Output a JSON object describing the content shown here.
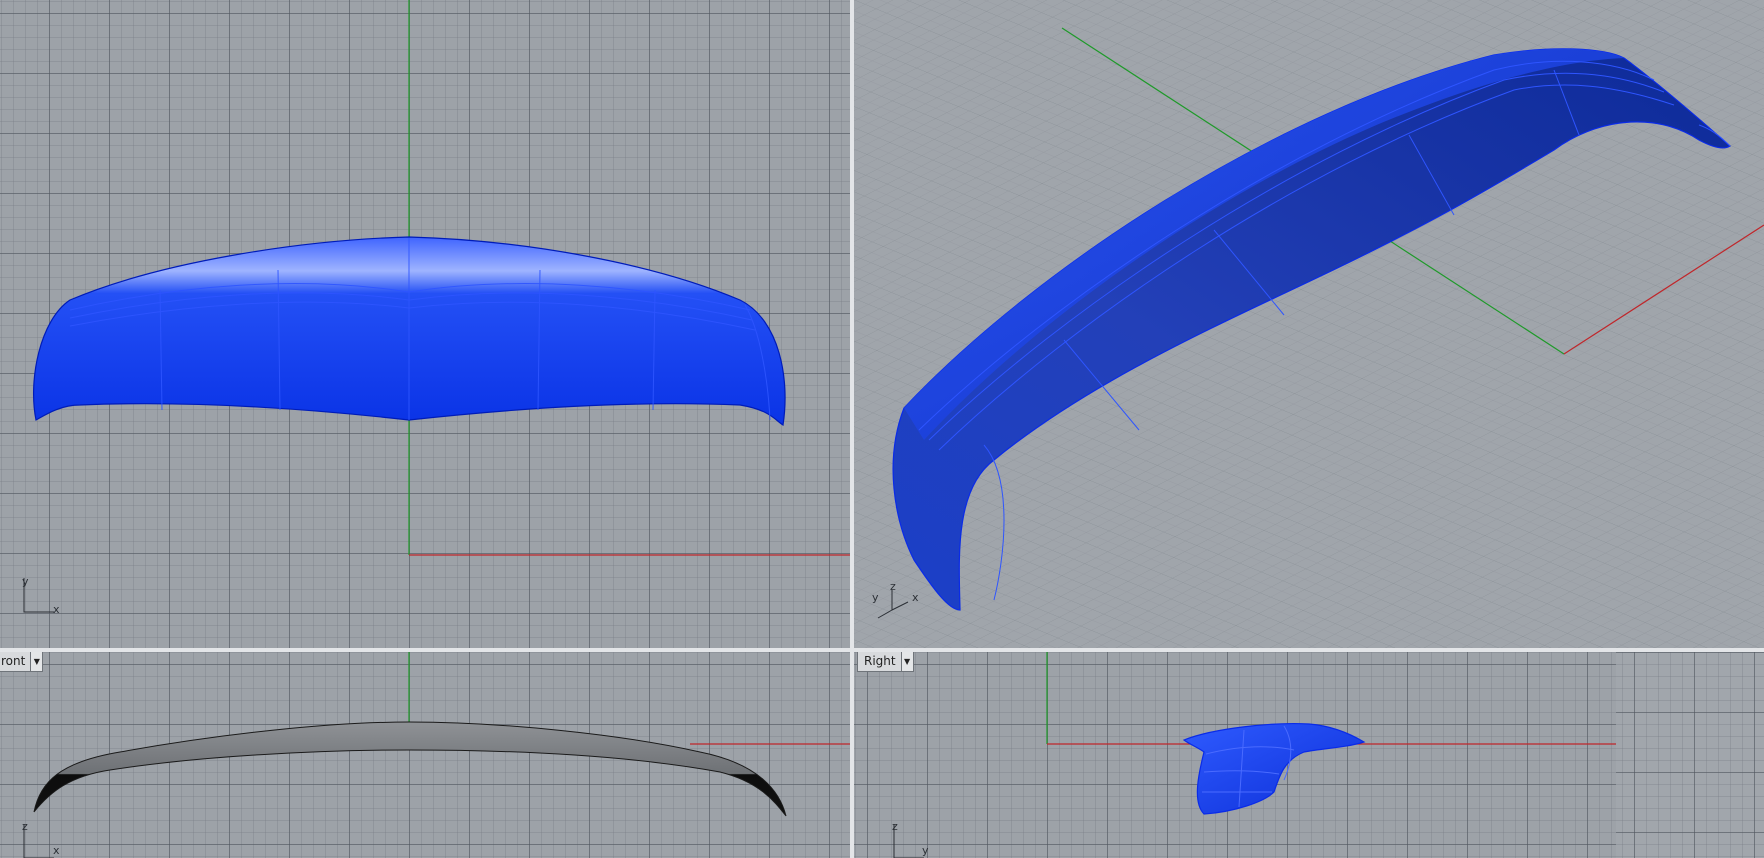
{
  "viewports": {
    "top": {
      "axis_x": "x",
      "axis_y": "y"
    },
    "perspective": {
      "axis_x": "x",
      "axis_y": "y",
      "axis_z": "z"
    },
    "front": {
      "tab_label": "ront",
      "axis_x": "x",
      "axis_z": "z"
    },
    "right": {
      "tab_label": "Right",
      "axis_y": "y",
      "axis_z": "z"
    }
  },
  "colors": {
    "model_blue": "#0a2fe0",
    "x_axis": "#c0262a",
    "y_axis": "#1f9a2a",
    "grid_bg": "#9da2a8",
    "divider": "#e3e5e8"
  },
  "icons": {
    "dropdown": "chevron-down-icon",
    "axis_widget": "axis-triad-icon"
  }
}
